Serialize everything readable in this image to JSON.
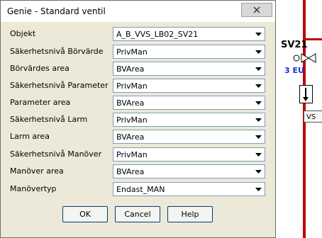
{
  "dialog": {
    "title": "Genie - Standard ventil",
    "fields": [
      {
        "label": "Objekt",
        "value": "A_B_VVS_LB02_SV21"
      },
      {
        "label": "Säkerhetsnivå Börvärde",
        "value": "PrivMan"
      },
      {
        "label": "Börvärdes area",
        "value": "BVArea"
      },
      {
        "label": "Säkerhetsnivå Parameter",
        "value": "PrivMan"
      },
      {
        "label": "Parameter area",
        "value": "BVArea"
      },
      {
        "label": "Säkerhetsnivå Larm",
        "value": "PrivMan"
      },
      {
        "label": "Larm area",
        "value": "BVArea"
      },
      {
        "label": "Säkerhetsnivå Manöver",
        "value": "PrivMan"
      },
      {
        "label": "Manöver area",
        "value": "BVArea"
      },
      {
        "label": "Manövertyp",
        "value": "Endast_MAN"
      }
    ],
    "buttons": {
      "ok": "OK",
      "cancel": "Cancel",
      "help": "Help"
    }
  },
  "background": {
    "valve_label": "SV21",
    "valve_eu": "3 EU",
    "vs_label": "VS"
  },
  "colors": {
    "pipe": "#c00000",
    "eu_text": "#1f2fd0",
    "dialog_bg": "#ece9d8"
  }
}
